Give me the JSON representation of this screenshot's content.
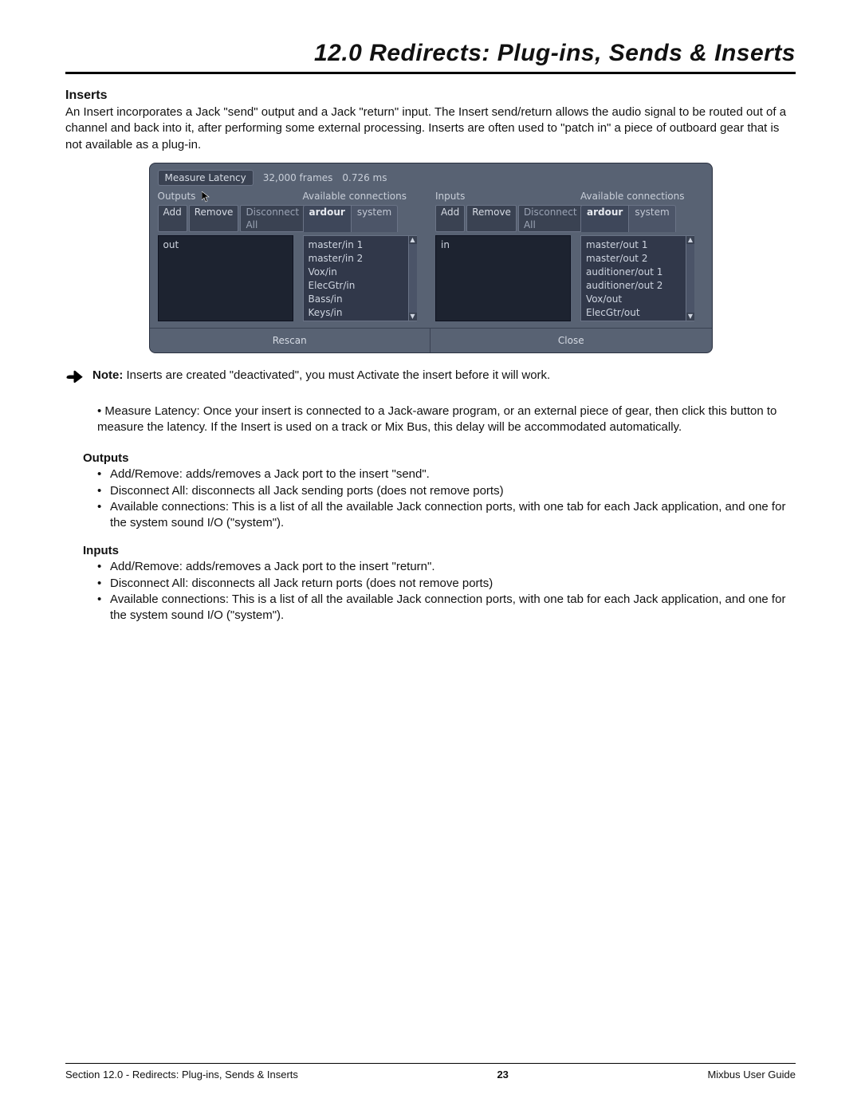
{
  "page": {
    "title": "12.0 Redirects:  Plug-ins, Sends & Inserts",
    "inserts_heading": "Inserts",
    "inserts_body": "An Insert incorporates a Jack \"send\" output and a Jack \"return\" input.  The Insert send/return allows the audio signal to be routed out of a channel and back into it, after performing some external processing.  Inserts are often used to \"patch in\" a piece of outboard gear that is not available as a plug-in.",
    "note_label": "Note:",
    "note_text": "  Inserts are created \"deactivated\", you must Activate the insert before it will work.",
    "measure_para": "•  Measure Latency:  Once your insert is connected to a Jack-aware program, or an external piece of gear, then click this button to measure the latency.  If the Insert is used on a track or Mix Bus, this delay will be accommodated automatically.",
    "outputs_heading": "Outputs",
    "outputs_items": [
      "Add/Remove:  adds/removes a Jack port to the insert \"send\".",
      "Disconnect All:  disconnects all Jack sending ports  (does not remove ports)",
      "Available connections:  This is a list of all the available Jack connection ports, with one tab for each Jack application, and one for the system sound I/O (\"system\")."
    ],
    "inputs_heading": "Inputs",
    "inputs_items": [
      "Add/Remove:  adds/removes a Jack port to the insert \"return\".",
      "Disconnect All:  disconnects all Jack return ports  (does not remove ports)",
      "Available connections:  This is a list of all the available Jack connection ports, with one tab for each Jack application, and one for the system sound I/O (\"system\")."
    ],
    "footer_left": "Section 12.0 - Redirects:  Plug-ins, Sends & Inserts",
    "footer_mid": "23",
    "footer_right": "Mixbus User Guide"
  },
  "dialog": {
    "measure_latency": "Measure Latency",
    "frames": "32,000 frames",
    "ms": "0.726 ms",
    "outputs_label": "Outputs",
    "inputs_label": "Inputs",
    "avail_label": "Available connections",
    "add": "Add",
    "remove": "Remove",
    "disconnect_all": "Disconnect All",
    "tab_ardour": "ardour",
    "tab_system": "system",
    "out_list": [
      "out"
    ],
    "in_list": [
      "in"
    ],
    "out_conn": [
      "master/in 1",
      "master/in 2",
      "Vox/in",
      "ElecGtr/in",
      "Bass/in",
      "Keys/in"
    ],
    "in_conn": [
      "master/out 1",
      "master/out 2",
      "auditioner/out 1",
      "auditioner/out 2",
      "Vox/out",
      "ElecGtr/out"
    ],
    "rescan": "Rescan",
    "close": "Close"
  }
}
